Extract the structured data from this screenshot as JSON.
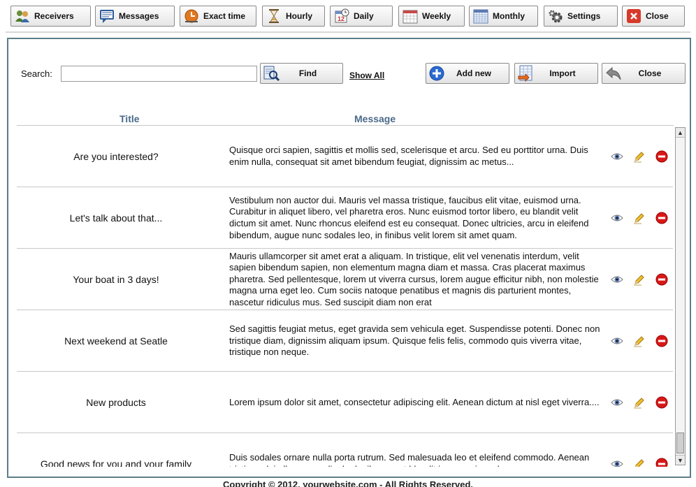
{
  "toolbar": {
    "receivers": "Receivers",
    "messages": "Messages",
    "exact_time": "Exact time",
    "hourly": "Hourly",
    "daily": "Daily",
    "weekly": "Weekly",
    "monthly": "Monthly",
    "settings": "Settings",
    "close": "Close",
    "daily_icon_number": "12"
  },
  "search": {
    "label": "Search:",
    "value": "",
    "find": "Find",
    "show_all": "Show All"
  },
  "actions": {
    "add_new": "Add new",
    "import": "Import",
    "close": "Close"
  },
  "table": {
    "columns": [
      "Title",
      "Message"
    ],
    "rows": [
      {
        "title": "Are you interested?",
        "message": "Quisque orci sapien, sagittis et mollis sed, scelerisque et arcu. Sed eu porttitor urna. Duis enim nulla, consequat sit amet bibendum feugiat, dignissim ac metus..."
      },
      {
        "title": "Let's talk about that...",
        "message": "Vestibulum non auctor dui. Mauris vel massa tristique, faucibus elit vitae, euismod urna. Curabitur in aliquet libero, vel pharetra eros. Nunc euismod tortor libero, eu blandit velit dictum sit amet. Nunc rhoncus eleifend est eu consequat. Donec ultricies, arcu in eleifend bibendum, augue nunc sodales leo, in finibus velit lorem sit amet quam."
      },
      {
        "title": "Your boat in 3 days!",
        "message": "Mauris ullamcorper sit amet erat a aliquam. In tristique, elit vel venenatis interdum, velit sapien bibendum sapien, non elementum magna diam et massa. Cras placerat maximus pharetra. Sed pellentesque, lorem ut viverra cursus, lorem augue efficitur nibh, non molestie magna urna eget leo. Cum sociis natoque penatibus et magnis dis parturient montes, nascetur ridiculus mus. Sed suscipit diam non erat"
      },
      {
        "title": "Next weekend at Seatle",
        "message": "Sed sagittis feugiat metus, eget gravida sem vehicula eget. Suspendisse potenti. Donec non tristique diam, dignissim aliquam ipsum. Quisque felis felis, commodo quis viverra vitae, tristique non neque."
      },
      {
        "title": "New products",
        "message": "Lorem ipsum dolor sit amet, consectetur adipiscing elit. Aenean dictum at nisl eget viverra...."
      },
      {
        "title": "Good news for you and your family",
        "message": "Duis sodales ornare nulla porta rutrum. Sed malesuada leo et eleifend commodo. Aenean tristique dui ullamcorper ligula dapibus, eget blandit ipsum euismod."
      }
    ]
  },
  "scrollbar": {
    "position": 0.95
  },
  "footer": "Copyright © 2012, yourwebsite.com - All Rights Reserved."
}
